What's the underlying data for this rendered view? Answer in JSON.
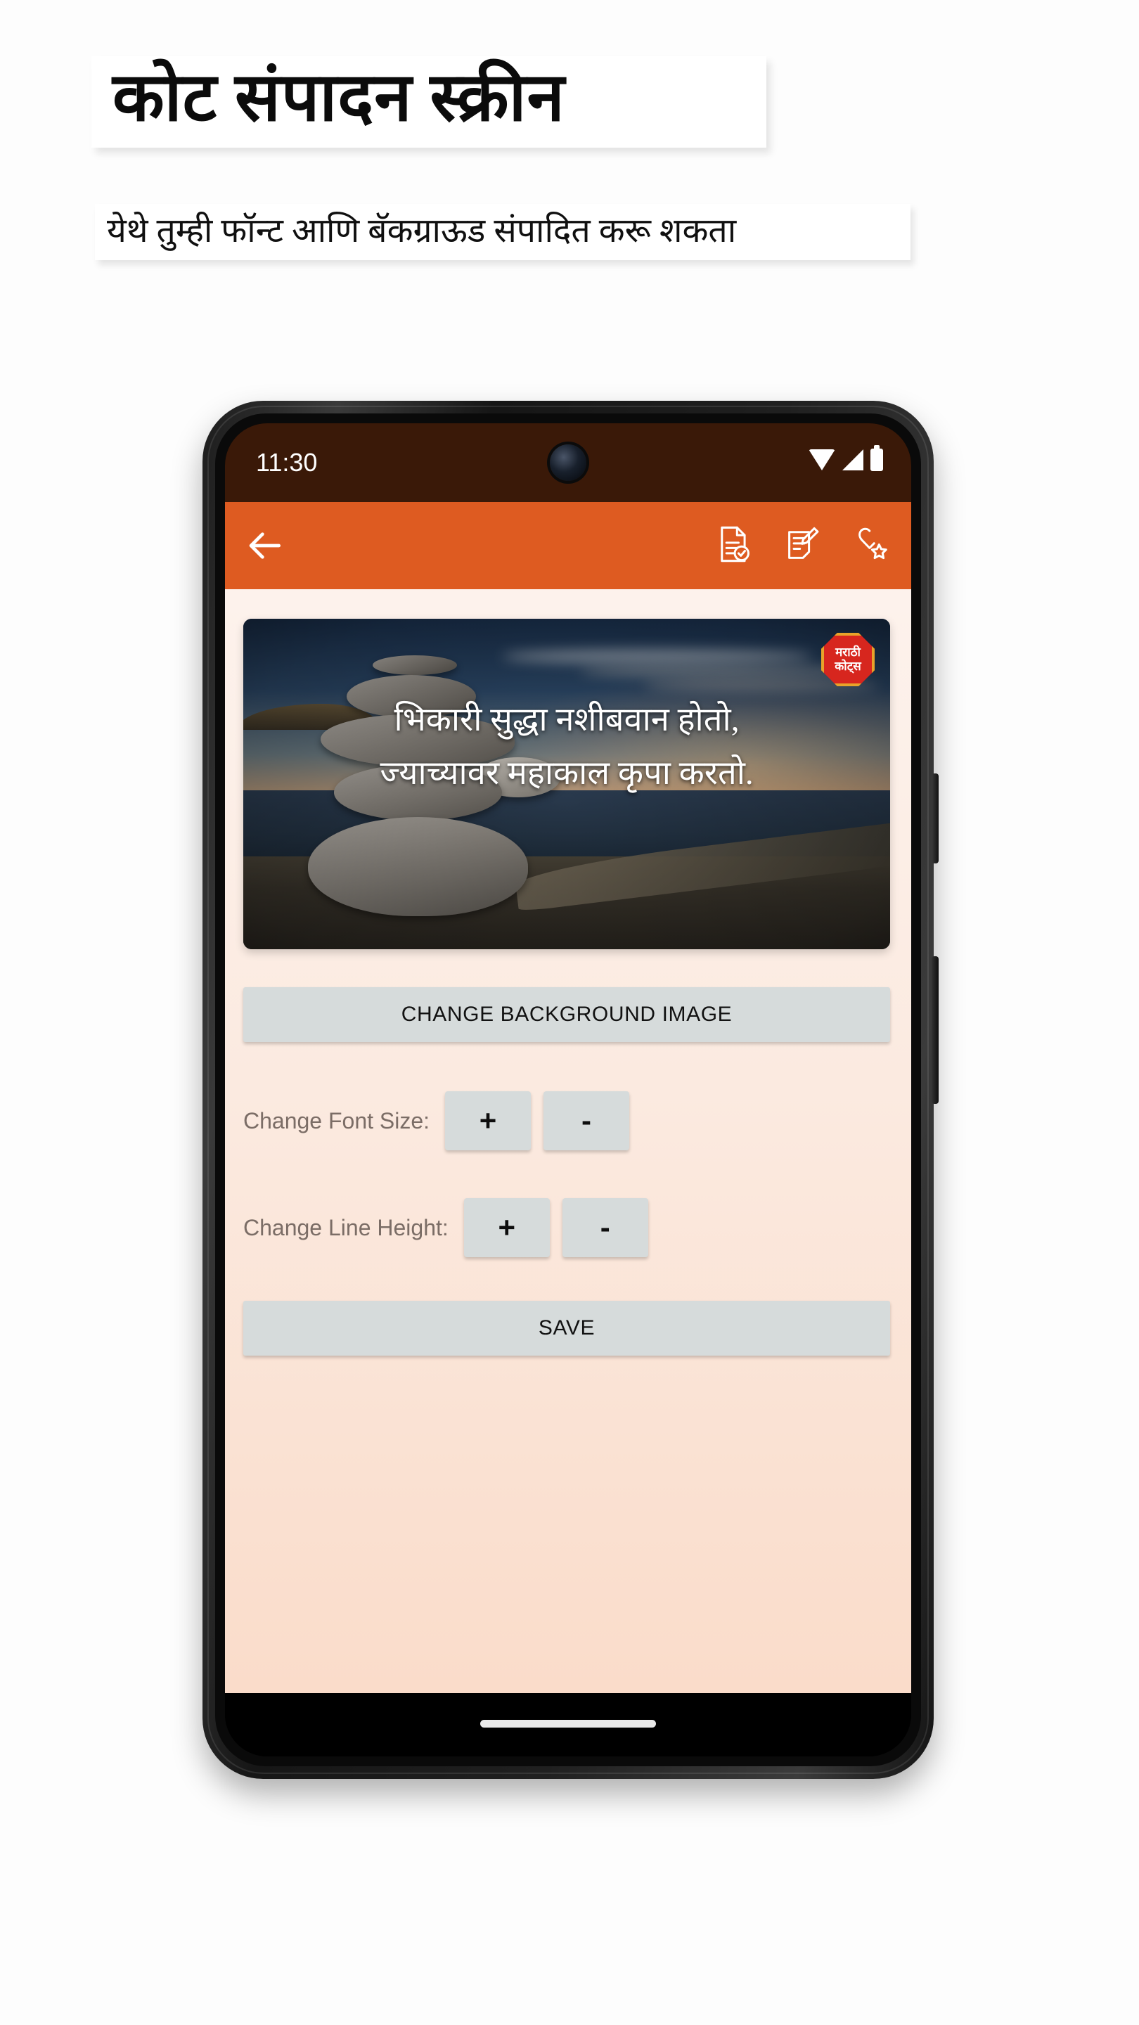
{
  "promo": {
    "title": "कोट संपादन स्क्रीन",
    "subtitle": "येथे तुम्ही फॉन्ट आणि बॅकग्राऊड संपादित करू शकता"
  },
  "colors": {
    "accent_orange": "#de5b21",
    "statusbar_brown": "#3a1908",
    "button_gray": "#d6dbdb",
    "content_bg_top": "#fdf2ec",
    "content_bg_bottom": "#fadcca",
    "watermark_red": "#d7261e",
    "watermark_border": "#e8a32a",
    "label_gray": "#7b6d66"
  },
  "phone": {
    "statusbar": {
      "time": "11:30",
      "icons": [
        "wifi-icon",
        "signal-icon",
        "battery-icon"
      ],
      "camera": "punch-hole-camera"
    },
    "appbar": {
      "back_icon": "back-arrow-icon",
      "actions": [
        {
          "name": "document-check-icon",
          "label": ""
        },
        {
          "name": "edit-document-icon",
          "label": ""
        },
        {
          "name": "heart-star-favorite-icon",
          "label": ""
        }
      ]
    },
    "quote_card": {
      "line1": "भिकारी सुद्धा नशीबवान होतो,",
      "line2": "ज्याच्यावर महाकाल कृपा करतो.",
      "watermark_line1": "मराठी",
      "watermark_line2": "कोट्स"
    },
    "controls": {
      "change_background_label": "CHANGE BACKGROUND IMAGE",
      "font_size_label": "Change Font Size:",
      "line_height_label": "Change Line Height:",
      "plus_label": "+",
      "minus_label": "-",
      "save_label": "SAVE"
    },
    "gesture_bar": "home-indicator"
  }
}
